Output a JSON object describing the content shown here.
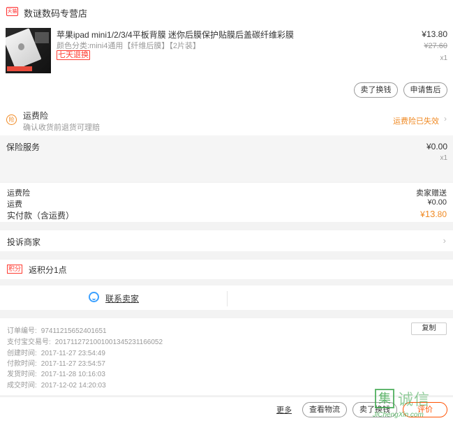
{
  "shop": {
    "logo_text": "天猫",
    "name": "数谜数码专营店",
    "chevron": "›"
  },
  "product": {
    "title": "苹果ipad mini1/2/3/4平板背膜 迷你后膜保护贴膜后盖碳纤维彩膜",
    "sku": "颜色分类:mini4通用【纤维后膜】【2片装】",
    "badge": "七天退换",
    "price": "¥13.80",
    "original_price": "¥27.60",
    "quantity": "x1",
    "btn_exchange": "卖了换钱",
    "btn_aftersale": "申请售后"
  },
  "insurance": {
    "icon_text": "险",
    "title": "运费险",
    "subtitle": "确认收货前退货可理赔",
    "status": "运费险已失效",
    "chevron": "›"
  },
  "protection": {
    "title": "保险服务",
    "price": "¥0.00",
    "quantity": "x1"
  },
  "summary": {
    "insurance_label": "运费险",
    "insurance_value": "卖家赠送",
    "freight_label": "运费",
    "freight_value": "¥0.00",
    "paid_label": "实付款（含运费）",
    "paid_currency": "¥",
    "paid_int": "13",
    "paid_dec": ".80"
  },
  "complain": {
    "label": "投诉商家",
    "chevron": "›"
  },
  "points": {
    "badge": "积分",
    "text": "返积分1点"
  },
  "contact": {
    "label": "联系卖家"
  },
  "order_info": {
    "copy_label": "复制",
    "rows": [
      {
        "label": "订单编号:",
        "value": "97411215652401651"
      },
      {
        "label": "支付宝交易号:",
        "value": "2017112721001001345231166052"
      },
      {
        "label": "创建时间:",
        "value": "2017-11-27 23:54:49"
      },
      {
        "label": "付款时间:",
        "value": "2017-11-27 23:54:57"
      },
      {
        "label": "发货时间:",
        "value": "2017-11-28 10:16:03"
      },
      {
        "label": "成交时间:",
        "value": "2017-12-02 14:20:03"
      }
    ]
  },
  "bottom_bar": {
    "more": "更多",
    "logistics": "查看物流",
    "exchange": "卖了换钱",
    "review": "评价"
  },
  "watermark": {
    "box_char": "集",
    "cn": "诚信",
    "en": "JiChengXin.com"
  },
  "colors": {
    "accent_orange": "#f08a24",
    "tmall_red": "#ff2c2c",
    "review_orange": "#ff5000",
    "link_blue": "#3ba0ff"
  }
}
